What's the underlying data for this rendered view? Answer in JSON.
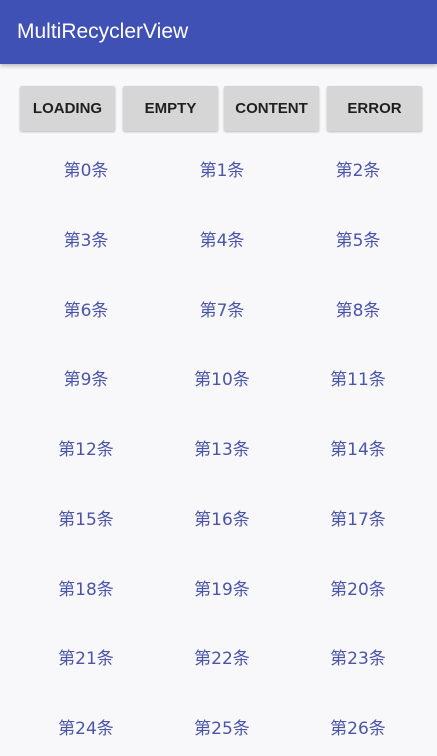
{
  "app_bar": {
    "title": "MultiRecyclerView",
    "color": "#3f51b5"
  },
  "buttons": [
    {
      "label": "LOADING"
    },
    {
      "label": "EMPTY"
    },
    {
      "label": "CONTENT"
    },
    {
      "label": "ERROR"
    }
  ],
  "list": {
    "columns": 3,
    "text_color": "#4b55a8",
    "items": [
      "第0条",
      "第1条",
      "第2条",
      "第3条",
      "第4条",
      "第5条",
      "第6条",
      "第7条",
      "第8条",
      "第9条",
      "第10条",
      "第11条",
      "第12条",
      "第13条",
      "第14条",
      "第15条",
      "第16条",
      "第17条",
      "第18条",
      "第19条",
      "第20条",
      "第21条",
      "第22条",
      "第23条",
      "第24条",
      "第25条",
      "第26条"
    ]
  }
}
